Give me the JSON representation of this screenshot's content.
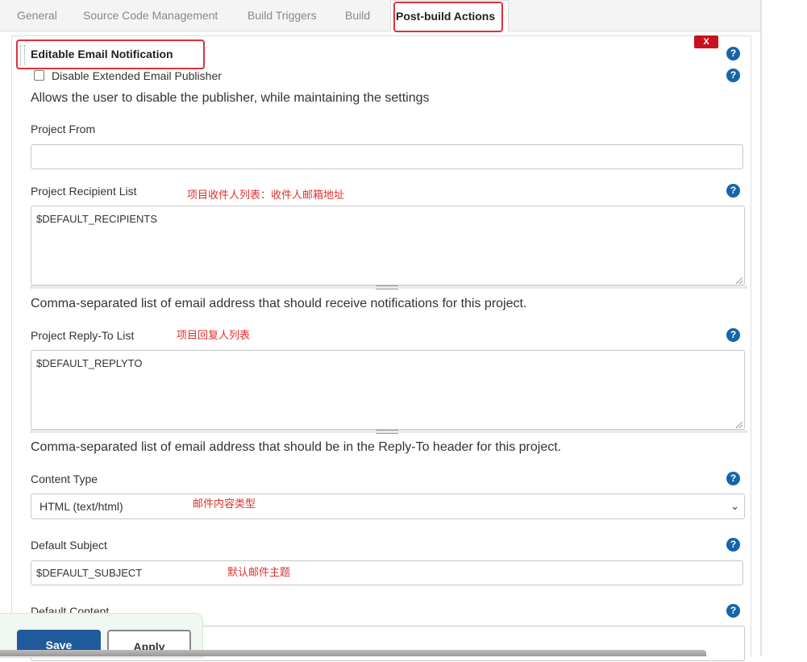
{
  "tabs": [
    {
      "label": "General"
    },
    {
      "label": "Source Code Management"
    },
    {
      "label": "Build Triggers"
    },
    {
      "label": "Build"
    },
    {
      "label": "Post-build Actions"
    }
  ],
  "section": {
    "title": "Editable Email Notification",
    "delete_label": "X",
    "help_glyph": "?"
  },
  "disable_publisher": {
    "label": "Disable Extended Email Publisher",
    "checked": false,
    "description": "Allows the user to disable the publisher, while maintaining the settings"
  },
  "project_from": {
    "label": "Project From",
    "value": ""
  },
  "recipient_list": {
    "label": "Project Recipient List",
    "annotation": "项目收件人列表：收件人邮箱地址",
    "value": "$DEFAULT_RECIPIENTS",
    "description": "Comma-separated list of email address that should receive notifications for this project."
  },
  "reply_to": {
    "label": "Project Reply-To List",
    "annotation": "项目回复人列表",
    "value": "$DEFAULT_REPLYTO",
    "description": "Comma-separated list of email address that should be in the Reply-To header for this project."
  },
  "content_type": {
    "label": "Content Type",
    "annotation": "邮件内容类型",
    "selected": "HTML (text/html)"
  },
  "default_subject": {
    "label": "Default Subject",
    "annotation": "默认邮件主题",
    "value": "$DEFAULT_SUBJECT"
  },
  "default_content": {
    "label": "Default Content"
  },
  "actions": {
    "save": "Save",
    "apply": "Apply"
  },
  "colors": {
    "highlight": "#e0303c",
    "help_icon": "#1565a8",
    "delete_button": "#c8101e",
    "save_button": "#1f5a9c",
    "annotation_text": "#e0302c"
  }
}
